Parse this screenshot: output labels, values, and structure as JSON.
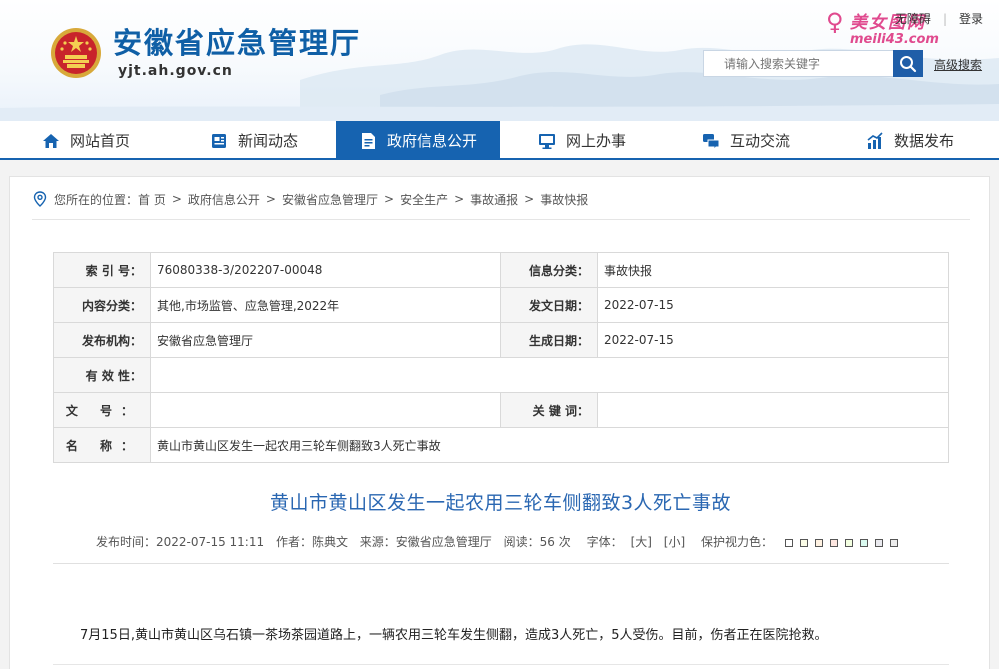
{
  "header": {
    "site_title": "安徽省应急管理厅",
    "site_domain": "yjt.ah.gov.cn",
    "top_links": {
      "link1": "无障碍",
      "login": "登录"
    },
    "watermark": {
      "title": "美女图网",
      "url": "meili43.com"
    },
    "search": {
      "placeholder": "请输入搜索关键字"
    },
    "advanced_search": "高级搜索"
  },
  "nav": {
    "items": [
      {
        "label": "网站首页",
        "icon": "home-icon"
      },
      {
        "label": "新闻动态",
        "icon": "news-icon"
      },
      {
        "label": "政府信息公开",
        "icon": "document-icon",
        "active": true
      },
      {
        "label": "网上办事",
        "icon": "monitor-icon"
      },
      {
        "label": "互动交流",
        "icon": "chat-icon"
      },
      {
        "label": "数据发布",
        "icon": "chart-icon"
      }
    ]
  },
  "breadcrumb": {
    "prefix": "您所在的位置：",
    "items": [
      "首 页",
      "政府信息公开",
      "安徽省应急管理厅",
      "安全生产",
      "事故通报",
      "事故快报"
    ],
    "separator": ">"
  },
  "info": {
    "index_label": "索 引 号：",
    "index_value": "76080338-3/202207-00048",
    "category_label": "信息分类：",
    "category_value": "事故快报",
    "content_label": "内容分类：",
    "content_value": "其他,市场监管、应急管理,2022年",
    "date_label": "发文日期：",
    "date_value": "2022-07-15",
    "org_label": "发布机构：",
    "org_value": "安徽省应急管理厅",
    "effective_label": "生成日期：",
    "effective_value": "2022-07-15",
    "validity_label": "有 效 性：",
    "validity_value": "",
    "docno_label": "文 号：",
    "docno_value": "",
    "keywords_label": "关 键 词：",
    "keywords_value": "",
    "name_label": "名 称：",
    "name_value": "黄山市黄山区发生一起农用三轮车侧翻致3人死亡事故"
  },
  "article": {
    "title": "黄山市黄山区发生一起农用三轮车侧翻致3人死亡事故",
    "meta": {
      "publish_time": "发布时间：2022-07-15 11:11",
      "author": "作者：陈典文",
      "source": "来源：安徽省应急管理厅",
      "views": "阅读：56 次",
      "font_label": "字体：",
      "font_large": "[大]",
      "font_small": "[小]",
      "eye_label": "保护视力色："
    },
    "body": "7月15日,黄山市黄山区乌石镇一茶场茶园道路上，一辆农用三轮车发生侧翻，造成3人死亡，5人受伤。目前，伤者正在医院抢救。"
  },
  "colors": {
    "brand_blue": "#1663b0",
    "title_blue": "#2a67b2",
    "eye_swatches": [
      "#ffffff",
      "#fafbe6",
      "#fff2e2",
      "#fde6e0",
      "#f3ffe1",
      "#dafaf0",
      "#eaeaef",
      "#ececec"
    ]
  }
}
